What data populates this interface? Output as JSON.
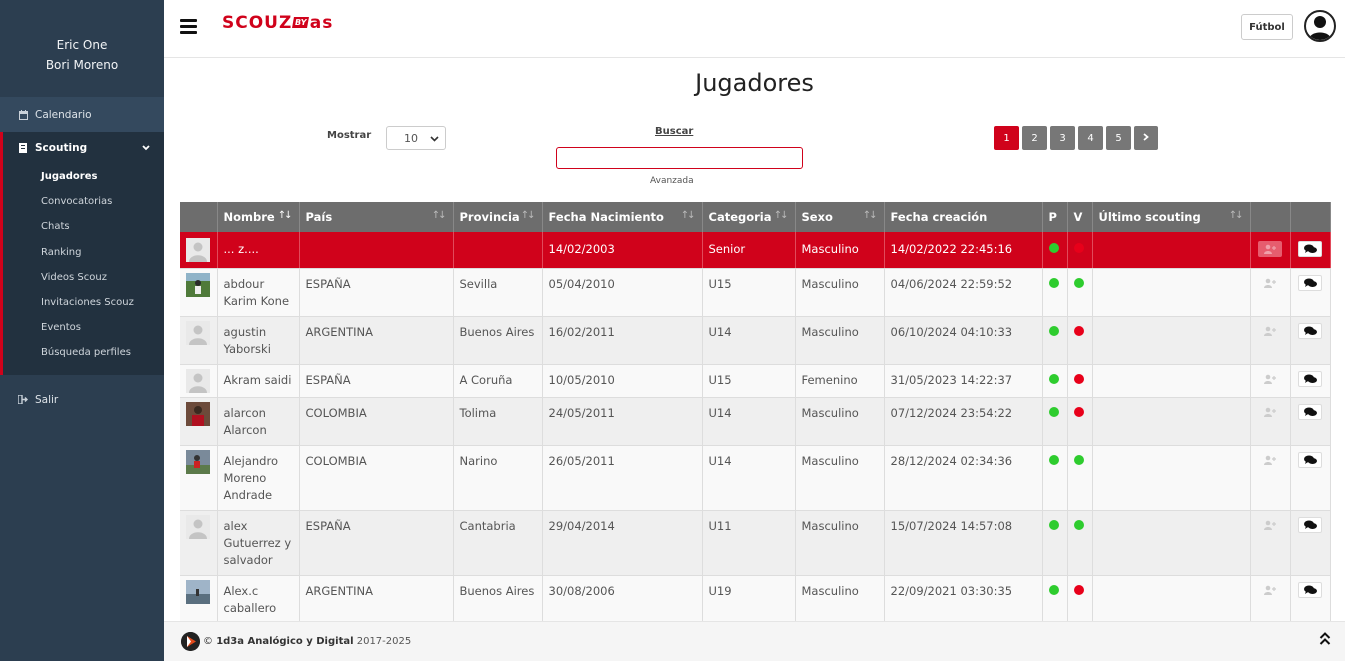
{
  "sidebar": {
    "user_line1": "Eric One",
    "user_line2": "Bori Moreno",
    "calendario": "Calendario",
    "scouting": "Scouting",
    "sub_items": [
      "Jugadores",
      "Convocatorias",
      "Chats",
      "Ranking",
      "Videos Scouz",
      "Invitaciones Scouz",
      "Eventos",
      "Búsqueda perfiles"
    ],
    "salir": "Salir"
  },
  "header": {
    "logo_left": "SCOUZ",
    "logo_by": "BY",
    "logo_right": "as",
    "sport_button": "Fútbol"
  },
  "main": {
    "title": "Jugadores",
    "mostrar_label": "Mostrar",
    "page_length": "10",
    "buscar_label": "Buscar",
    "search_value": "",
    "avanzada_label": "Avanzada",
    "pages": [
      "1",
      "2",
      "3",
      "4",
      "5"
    ],
    "active_page": "1"
  },
  "table": {
    "headers": [
      "Nombre",
      "País",
      "Provincia",
      "Fecha Nacimiento",
      "Categoria",
      "Sexo",
      "Fecha creación",
      "P",
      "V",
      "Último scouting"
    ],
    "rows": [
      {
        "name": "... z....",
        "pais": "",
        "provincia": "",
        "nacimiento": "14/02/2003",
        "categoria": "Senior",
        "sexo": "Masculino",
        "creacion": "14/02/2022 22:45:16",
        "p": "green",
        "v": "red",
        "ultimo": "",
        "photo": "placeholder"
      },
      {
        "name": "abdour Karim Kone",
        "pais": "ESPAÑA",
        "provincia": "Sevilla",
        "nacimiento": "05/04/2010",
        "categoria": "U15",
        "sexo": "Masculino",
        "creacion": "04/06/2024 22:59:52",
        "p": "green",
        "v": "green",
        "ultimo": "",
        "photo": "field"
      },
      {
        "name": "agustin Yaborski",
        "pais": "ARGENTINA",
        "provincia": "Buenos Aires",
        "nacimiento": "16/02/2011",
        "categoria": "U14",
        "sexo": "Masculino",
        "creacion": "06/10/2024 04:10:33",
        "p": "green",
        "v": "red",
        "ultimo": "",
        "photo": "placeholder"
      },
      {
        "name": "Akram saidi",
        "pais": "ESPAÑA",
        "provincia": "A Coruña",
        "nacimiento": "10/05/2010",
        "categoria": "U15",
        "sexo": "Femenino",
        "creacion": "31/05/2023 14:22:37",
        "p": "green",
        "v": "red",
        "ultimo": "",
        "photo": "placeholder"
      },
      {
        "name": "alarcon Alarcon",
        "pais": "COLOMBIA",
        "provincia": "Tolima",
        "nacimiento": "24/05/2011",
        "categoria": "U14",
        "sexo": "Masculino",
        "creacion": "07/12/2024 23:54:22",
        "p": "green",
        "v": "red",
        "ultimo": "",
        "photo": "red-shirt"
      },
      {
        "name": "Alejandro Moreno Andrade",
        "pais": "COLOMBIA",
        "provincia": "Narino",
        "nacimiento": "26/05/2011",
        "categoria": "U14",
        "sexo": "Masculino",
        "creacion": "28/12/2024 02:34:36",
        "p": "green",
        "v": "green",
        "ultimo": "",
        "photo": "action"
      },
      {
        "name": "alex Gutuerrez y salvador",
        "pais": "ESPAÑA",
        "provincia": "Cantabria",
        "nacimiento": "29/04/2014",
        "categoria": "U11",
        "sexo": "Masculino",
        "creacion": "15/07/2024 14:57:08",
        "p": "green",
        "v": "green",
        "ultimo": "",
        "photo": "placeholder"
      },
      {
        "name": "Alex.c caballero",
        "pais": "ARGENTINA",
        "provincia": "Buenos Aires",
        "nacimiento": "30/08/2006",
        "categoria": "U19",
        "sexo": "Masculino",
        "creacion": "22/09/2021 03:30:35",
        "p": "green",
        "v": "red",
        "ultimo": "",
        "photo": "sky"
      }
    ]
  },
  "footer": {
    "copyright": "©",
    "company": "1d3a Analógico y Digital",
    "years": "2017-2025"
  },
  "colors": {
    "brand_red": "#d0021b",
    "sidebar_bg": "#2c3e50",
    "header_row": "#6d6d6d",
    "dot_green": "#2ecc2e",
    "dot_red": "#e8001a"
  }
}
